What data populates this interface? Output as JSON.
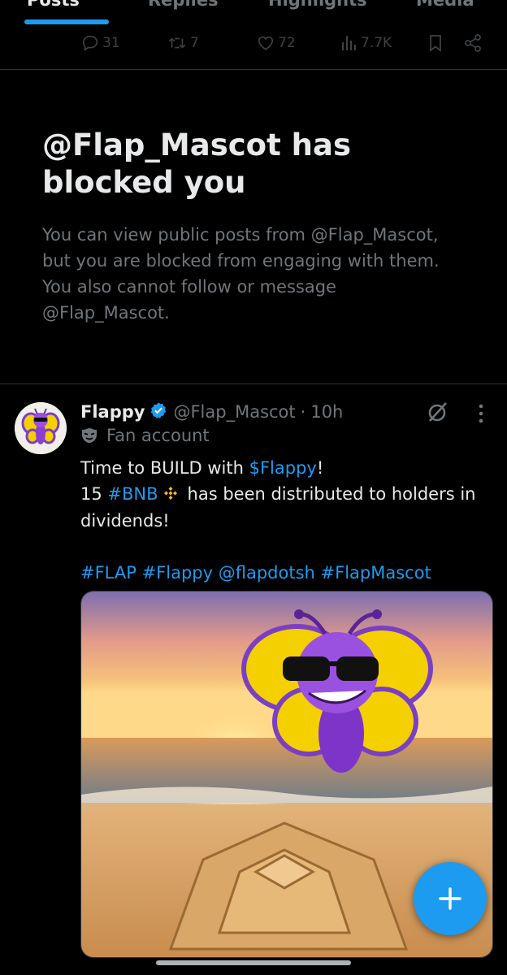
{
  "tabs": [
    {
      "label": "Posts",
      "active": true
    },
    {
      "label": "Replies",
      "active": false
    },
    {
      "label": "Highlights",
      "active": false
    },
    {
      "label": "Media",
      "active": false
    }
  ],
  "previous_post": {
    "replies": "31",
    "reposts": "7",
    "likes": "72",
    "views": "7.7K"
  },
  "blocked_notice": {
    "title": "@Flap_Mascot has blocked you",
    "description": "You can view public posts from @Flap_Mascot, but you are blocked from engaging with them. You also cannot follow or message @Flap_Mascot."
  },
  "tweet": {
    "display_name": "Flappy",
    "handle": "@Flap_Mascot",
    "separator": "·",
    "time": "10h",
    "label": "Fan account",
    "line1_prefix": "Time to BUILD with ",
    "line1_cashtag": "$Flappy",
    "line1_suffix": "!",
    "line2_prefix": "15 ",
    "line2_hashtag": "#BNB",
    "line2_suffix": "has been distributed to holders in",
    "line3": "dividends!",
    "tags": [
      "#FLAP",
      "#Flappy",
      "@flapdotsh",
      "#FlapMascot"
    ]
  },
  "icons": {
    "reply": "reply-icon",
    "repost": "repost-icon",
    "like": "heart-icon",
    "views": "views-icon",
    "bookmark": "bookmark-icon",
    "share": "share-icon",
    "verified": "verified-badge-icon",
    "grok": "grok-icon",
    "more": "more-vertical-icon",
    "fan": "mask-icon",
    "compose": "plus-icon"
  },
  "colors": {
    "background": "#000000",
    "accent": "#1d9bf0",
    "text_primary": "#e7e9ea",
    "text_secondary": "#71767b",
    "divider": "#2f3336"
  }
}
